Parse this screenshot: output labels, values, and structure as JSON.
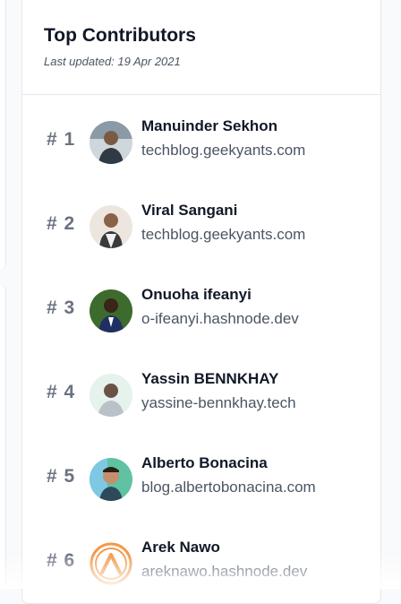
{
  "header": {
    "title": "Top Contributors",
    "subtitle": "Last updated: 19 Apr 2021"
  },
  "contributors": [
    {
      "rank": "#1",
      "name": "Manuinder Sekhon",
      "site": "techblog.geekyants.com",
      "avatar": "avatar-photo-icon"
    },
    {
      "rank": "#2",
      "name": "Viral Sangani",
      "site": "techblog.geekyants.com",
      "avatar": "avatar-photo-icon"
    },
    {
      "rank": "#3",
      "name": "Onuoha ifeanyi",
      "site": "o-ifeanyi.hashnode.dev",
      "avatar": "avatar-photo-icon"
    },
    {
      "rank": "#4",
      "name": "Yassin BENNKHAY",
      "site": "yassine-bennkhay.tech",
      "avatar": "avatar-photo-icon"
    },
    {
      "rank": "#5",
      "name": "Alberto Bonacina",
      "site": "blog.albertobonacina.com",
      "avatar": "avatar-photo-icon"
    },
    {
      "rank": "#6",
      "name": "Arek Nawo",
      "site": "areknawo.hashnode.dev",
      "avatar": "arch-logo-icon"
    }
  ],
  "colors": {
    "text_primary": "#111827",
    "text_secondary": "#4b5563",
    "rank": "#6b7280",
    "border": "#e5e7eb",
    "avatar6_accent": "#f2994a"
  }
}
